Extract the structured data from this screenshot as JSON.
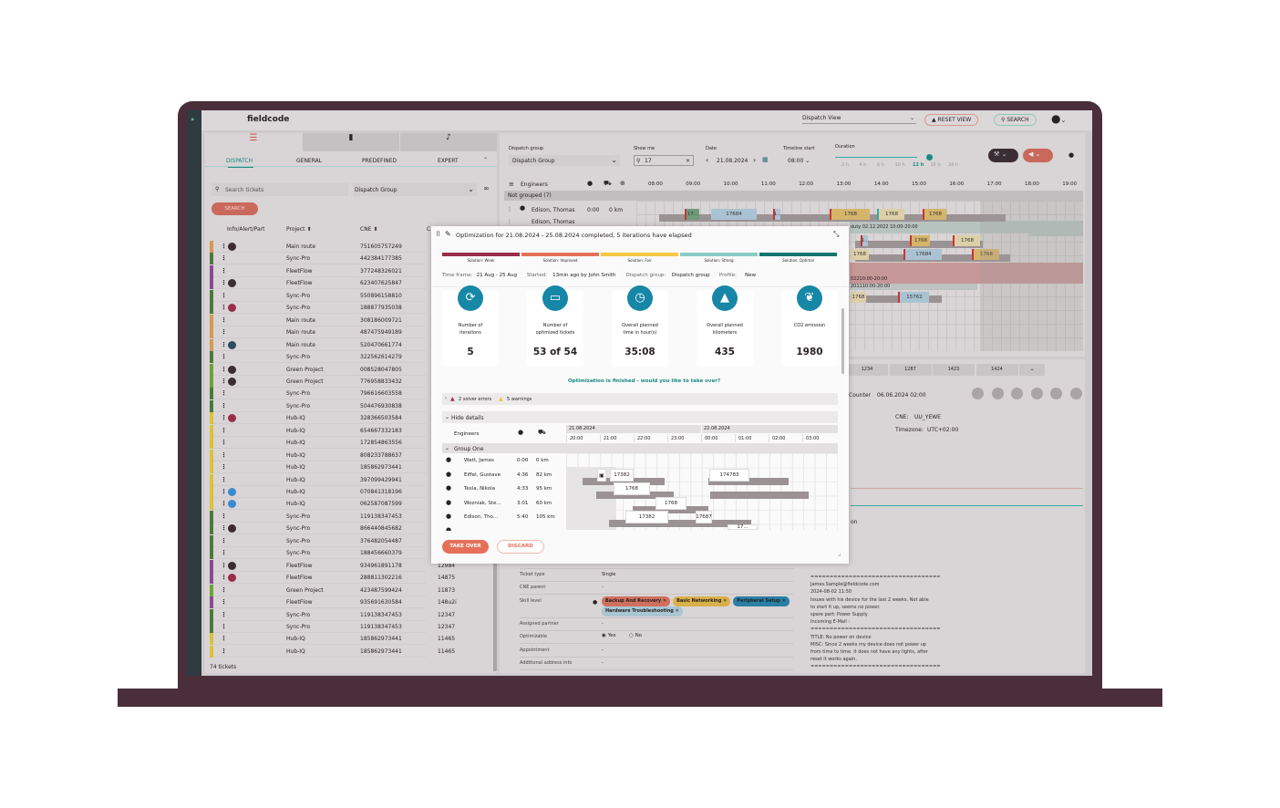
{
  "app": {
    "logo": "fieldcode",
    "rail_icon": "»"
  },
  "topbar": {
    "view_select": "Dispatch View",
    "reset_view": "RESET VIEW",
    "search": "SEARCH"
  },
  "left": {
    "subtabs": [
      "DISPATCH",
      "GENERAL",
      "PREDEFINED",
      "EXPERT"
    ],
    "search_placeholder": "Search tickets",
    "group_select": "Dispatch Group",
    "search_button": "SEARCH",
    "columns": [
      "Info/Alert/Part",
      "Project",
      "CNE",
      "C"
    ],
    "footer": "74 tickets",
    "rows": [
      {
        "c": "#d49a55",
        "i": "cam",
        "p": "Main route",
        "n": "751605757249",
        "x": ""
      },
      {
        "c": "#4b7a3a",
        "i": "",
        "p": "Sync-Pro",
        "n": "442384177385",
        "x": ""
      },
      {
        "c": "#8a4a92",
        "i": "",
        "p": "FleetFlow",
        "n": "377248326021",
        "x": ""
      },
      {
        "c": "#8a4a92",
        "i": "cam",
        "p": "FleetFlow",
        "n": "623407625847",
        "x": ""
      },
      {
        "c": "#4b7a3a",
        "i": "",
        "p": "Sync-Pro",
        "n": "550896158810",
        "x": ""
      },
      {
        "c": "#4b7a3a",
        "i": "alert",
        "p": "Sync-Pro",
        "n": "188877935038",
        "x": ""
      },
      {
        "c": "#d49a55",
        "i": "",
        "p": "Main route",
        "n": "308186009721",
        "x": ""
      },
      {
        "c": "#d49a55",
        "i": "",
        "p": "Main route",
        "n": "487475949189",
        "x": ""
      },
      {
        "c": "#d49a55",
        "i": "hand",
        "p": "Main route",
        "n": "520470661774",
        "x": ""
      },
      {
        "c": "#4b7a3a",
        "i": "",
        "p": "Sync-Pro",
        "n": "322562614279",
        "x": ""
      },
      {
        "c": "#6aa33a",
        "i": "cam",
        "p": "Green Project",
        "n": "008528047805",
        "x": ""
      },
      {
        "c": "#6aa33a",
        "i": "cam",
        "p": "Green Project",
        "n": "776958833432",
        "x": ""
      },
      {
        "c": "#4b7a3a",
        "i": "",
        "p": "Sync-Pro",
        "n": "796616603558",
        "x": ""
      },
      {
        "c": "#4b7a3a",
        "i": "",
        "p": "Sync-Pro",
        "n": "504476930838",
        "x": ""
      },
      {
        "c": "#d8c33a",
        "i": "alert",
        "p": "Hub-IQ",
        "n": "328366503584",
        "x": ""
      },
      {
        "c": "#d8c33a",
        "i": "",
        "p": "Hub-IQ",
        "n": "654667332183",
        "x": ""
      },
      {
        "c": "#d8c33a",
        "i": "",
        "p": "Hub-IQ",
        "n": "172854863556",
        "x": ""
      },
      {
        "c": "#d8c33a",
        "i": "",
        "p": "Hub-IQ",
        "n": "808233788637",
        "x": ""
      },
      {
        "c": "#d8c33a",
        "i": "",
        "p": "Hub-IQ",
        "n": "185862973441",
        "x": ""
      },
      {
        "c": "#d8c33a",
        "i": "",
        "p": "Hub-IQ",
        "n": "397099429941",
        "x": ""
      },
      {
        "c": "#d8c33a",
        "i": "hand-blue",
        "p": "Hub-IQ",
        "n": "070841318196",
        "x": ""
      },
      {
        "c": "#d8c33a",
        "i": "hand-blue",
        "p": "Hub-IQ",
        "n": "062587087599",
        "x": ""
      },
      {
        "c": "#4b7a3a",
        "i": "",
        "p": "Sync-Pro",
        "n": "119138347453",
        "x": ""
      },
      {
        "c": "#4b7a3a",
        "i": "cam",
        "p": "Sync-Pro",
        "n": "866440845682",
        "x": ""
      },
      {
        "c": "#4b7a3a",
        "i": "",
        "p": "Sync-Pro",
        "n": "376482054487",
        "x": ""
      },
      {
        "c": "#4b7a3a",
        "i": "",
        "p": "Sync-Pro",
        "n": "188456660379",
        "x": ""
      },
      {
        "c": "#8a4a92",
        "i": "cam",
        "p": "FleetFlow",
        "n": "934961891178",
        "x": "12984"
      },
      {
        "c": "#8a4a92",
        "i": "alert",
        "p": "FleetFlow",
        "n": "288811302216",
        "x": "14875"
      },
      {
        "c": "#6aa33a",
        "i": "",
        "p": "Green Project",
        "n": "423487599424",
        "x": "11873"
      },
      {
        "c": "#8a4a92",
        "i": "",
        "p": "FleetFlow",
        "n": "935691630584",
        "x": "148u2i"
      },
      {
        "c": "#4b7a3a",
        "i": "",
        "p": "Sync-Pro",
        "n": "119138347453",
        "x": "12347"
      },
      {
        "c": "#4b7a3a",
        "i": "",
        "p": "Sync-Pro",
        "n": "119138347453",
        "x": "12347"
      },
      {
        "c": "#d8c33a",
        "i": "",
        "p": "Hub-IQ",
        "n": "185862973441",
        "x": "11465"
      },
      {
        "c": "#d8c33a",
        "i": "",
        "p": "Hub-IQ",
        "n": "185862973441",
        "x": "11465"
      }
    ]
  },
  "timeline": {
    "labels": {
      "group": "Dispatch group",
      "show": "Show me",
      "date": "Date",
      "start": "Timeline start",
      "duration": "Duration"
    },
    "group_value": "Dispatch Group",
    "show_value": "17",
    "date_value": "21.08.2024",
    "start_value": "08:00",
    "durations": [
      "2 h",
      "4 h",
      "6 h",
      "10 h",
      "12 h",
      "16 h",
      "24 h"
    ],
    "duration_selected": "12 h",
    "engineers": "Engineers",
    "not_grouped": "Not grouped  (7)",
    "hours": [
      "08:00",
      "09:00",
      "10:00",
      "11:00",
      "12:00",
      "13:00",
      "14:00",
      "15:00",
      "16:00",
      "17:00",
      "18:00",
      "19:00"
    ],
    "rows": [
      {
        "name": "Edison, Thomas",
        "time": "0:00",
        "km": "0 km"
      },
      {
        "name": "Edison, Thomas",
        "time": "0:00",
        "km": "0 km"
      }
    ],
    "bars": [
      "17...",
      "17684",
      "1...",
      "1768",
      "1768",
      "1768",
      "1768",
      "1768",
      "1...",
      "1768",
      "17684",
      "1768",
      "1768",
      "15762"
    ],
    "duty1": "duty 02.12.2022 10:00-20:00",
    "duty2": "02210:00-20:00",
    "duty3": "201110:00-20:00"
  },
  "detail": {
    "tabs": [
      "1234",
      "1287",
      "1423",
      "1424"
    ],
    "counter_label": "Counter",
    "counter_value": "06.06.2024 02:00",
    "cne_label": "CNE:",
    "cne_value": "UU_YEWE",
    "tz_label": "Timezone:",
    "tz_value": "UTC+02:00",
    "partial": "on",
    "fields": [
      {
        "label": "Ticket type",
        "value": "Single"
      },
      {
        "label": "CNE parent",
        "value": "-"
      },
      {
        "label": "Skill level",
        "value": ""
      },
      {
        "label": "Assigned partner",
        "value": "-"
      },
      {
        "label": "Optimizable",
        "value": ""
      },
      {
        "label": "Appointment",
        "value": "-"
      },
      {
        "label": "Additional address info",
        "value": "-"
      }
    ],
    "skills": [
      {
        "t": "Backup And Recovery",
        "c": "#d0705e"
      },
      {
        "t": "Basic Networking",
        "c": "#d9b04a"
      },
      {
        "t": "Peripheral Setup",
        "c": "#2a7fa5"
      },
      {
        "t": "Hardware Troubleshooting",
        "c": "#a9c6d2"
      }
    ],
    "opt_yes": "Yes",
    "opt_no": "No",
    "notes": [
      "==================================",
      "James.Sample@fieldcode.com",
      "2024-08-02 11:50",
      "Issues with his device for the last 2 weeks. Not able",
      "to start it up, seems no power.",
      "spare part: Power Supply",
      "Incoming E-Mail :",
      "==================================",
      "TITLE: No power on device",
      "MISC: Since 2 weeks my device does not power up",
      "from time to time. It does not have any lights, after",
      "reset it works again.",
      "=================================="
    ]
  },
  "modal": {
    "title": "Optimization for 21.08.2024 - 25.08.2024 completed, 5 iterations have elapsed",
    "solutions": [
      {
        "t": "Solution: Weak",
        "c": "#9a2e4a"
      },
      {
        "t": "Solution: Improved",
        "c": "#e5705a"
      },
      {
        "t": "Solution: Fair",
        "c": "#f7c843"
      },
      {
        "t": "Solution: Strong",
        "c": "#8acbc5"
      },
      {
        "t": "Solution: Optimal",
        "c": "#11776e"
      }
    ],
    "meta": [
      "Time frame:",
      "21 Aug - 25 Aug",
      "Started:",
      "13min ago by John Smith",
      "Dispatch group:",
      "Dispatch group",
      "Profile:",
      "New"
    ],
    "stats": [
      {
        "l1": "Number of",
        "l2": "iterations",
        "v": "5",
        "icon": "refresh-icon",
        "g": "⟳"
      },
      {
        "l1": "Number of",
        "l2": "optimized tickets",
        "v": "53 of 54",
        "icon": "ticket-icon",
        "g": "▭"
      },
      {
        "l1": "Overall planned",
        "l2": "time in hour(s)",
        "v": "35:08",
        "icon": "clock-icon",
        "g": "◷"
      },
      {
        "l1": "Overall planned",
        "l2": "kilometers",
        "v": "435",
        "icon": "road-icon",
        "g": "▲"
      },
      {
        "l1": "CO2 emission",
        "l2": "",
        "v": "1980",
        "icon": "leaf-icon",
        "g": "❦"
      }
    ],
    "finished": "Optimization is finished - would you like to take over?",
    "errors": "2 solver errors",
    "warnings": "5 warnings",
    "hide_details": "Hide details",
    "engineers": "Engineers",
    "group": "Group One",
    "dates": [
      "21.08.2024",
      "22.08.2024"
    ],
    "hours": [
      "20:00",
      "21:00",
      "22:00",
      "23:00",
      "00:00",
      "01:00",
      "02:00",
      "03:00"
    ],
    "rows": [
      {
        "name": "Watt, James",
        "time": "0:00",
        "km": "0 km"
      },
      {
        "name": "Eiffel, Gustave",
        "time": "4:36",
        "km": "82 km"
      },
      {
        "name": "Tesla, Nikola",
        "time": "4:33",
        "km": "95 km"
      },
      {
        "name": "Wozniak, Ste...",
        "time": "3:01",
        "km": "60 km"
      },
      {
        "name": "Edison, Tho...",
        "time": "5:40",
        "km": "105 km"
      }
    ],
    "blocks": [
      "17382",
      "174783",
      "1768",
      "1768",
      "17382",
      "17687",
      "17..."
    ],
    "take_over": "TAKE OVER",
    "discard": "DISCARD"
  },
  "colors": {
    "accent": "#1787a7",
    "primary": "#e5705a",
    "teal": "#11776e",
    "frame": "#4a2e3a"
  }
}
